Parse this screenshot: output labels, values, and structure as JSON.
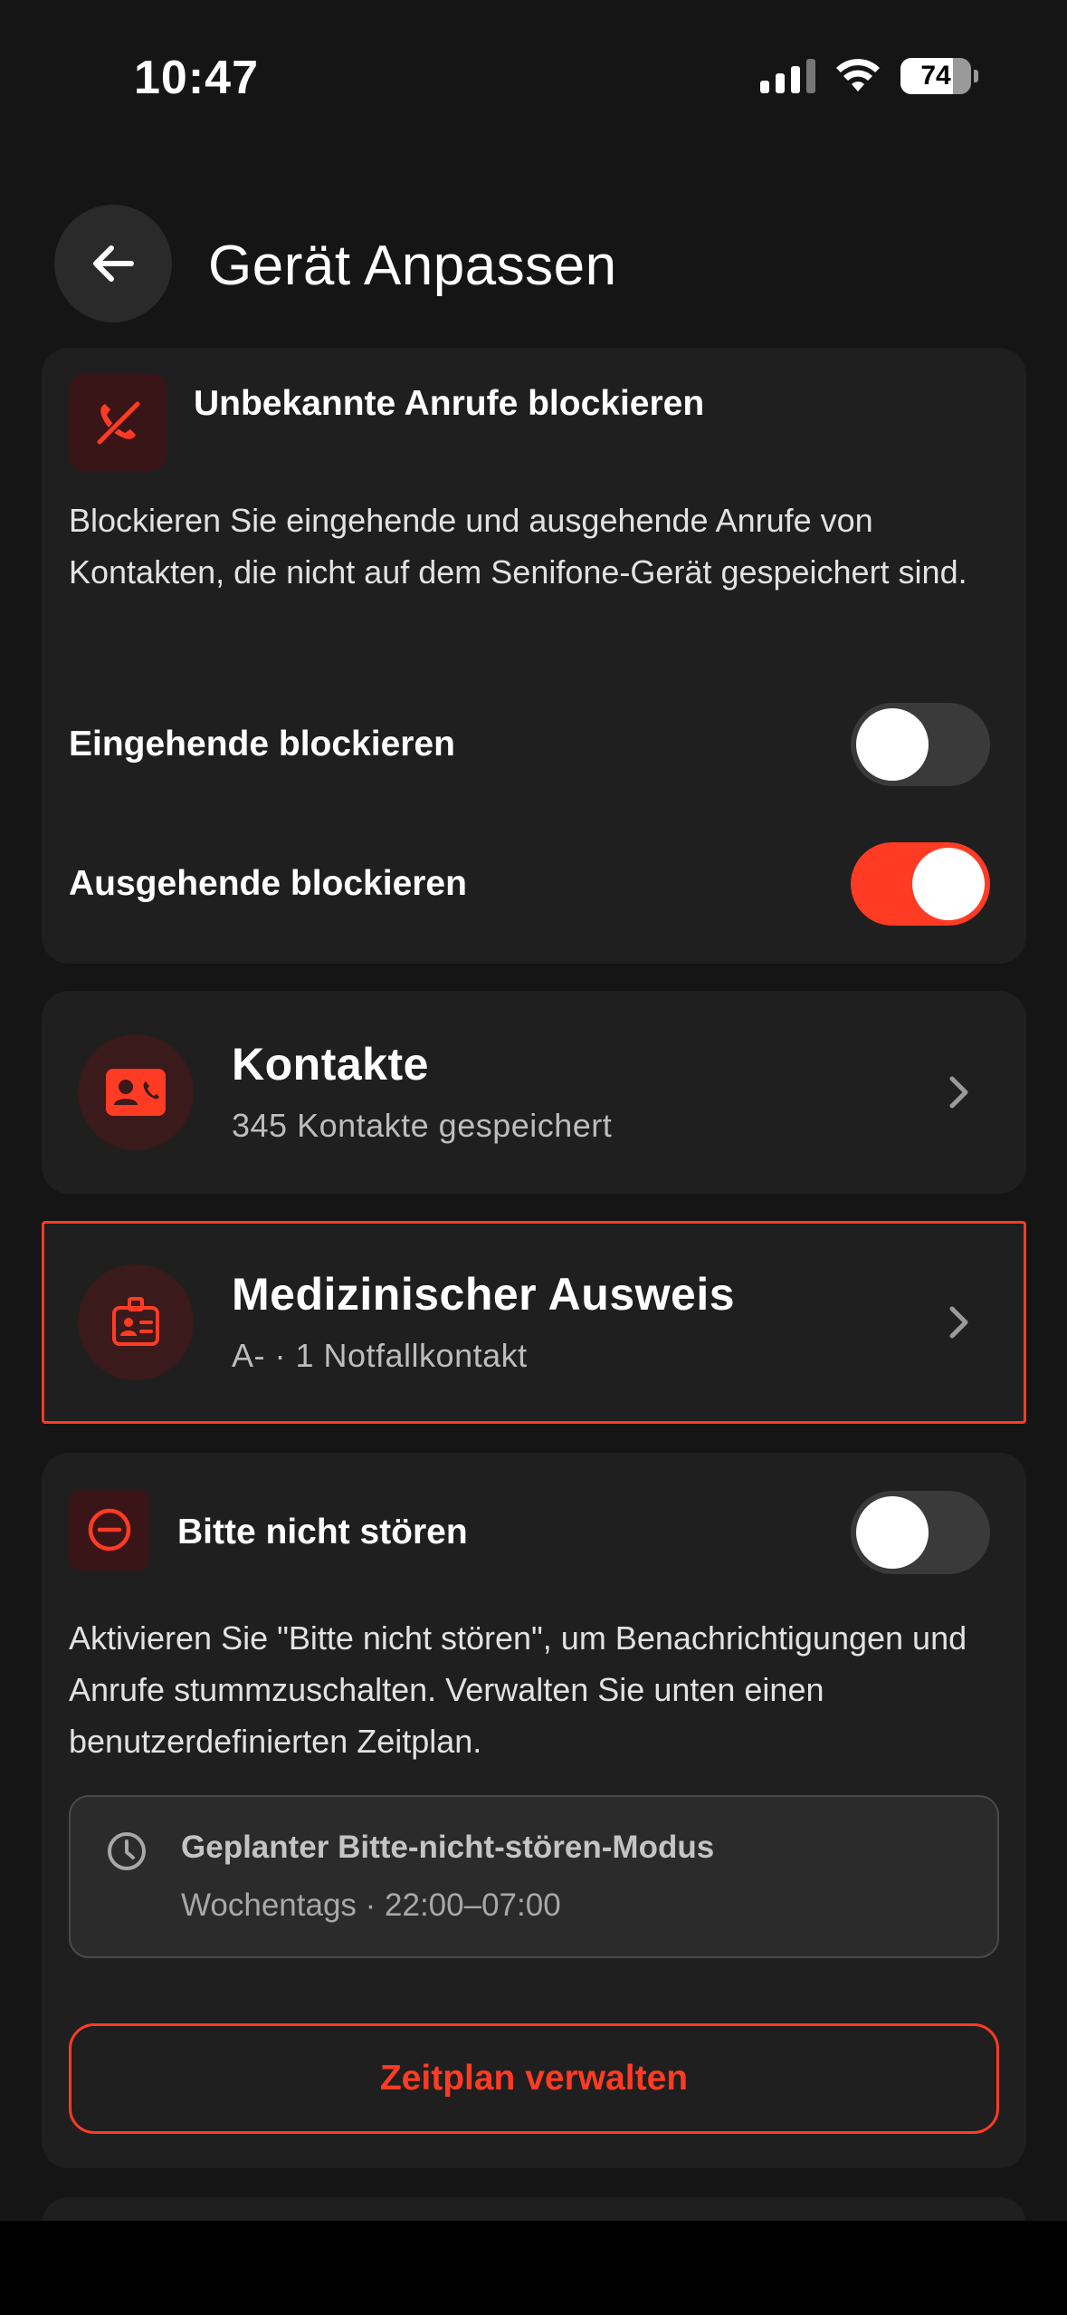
{
  "status_bar": {
    "time": "10:47",
    "battery": "74",
    "battery_level": 0.74
  },
  "header": {
    "title": "Gerät Anpassen"
  },
  "block_calls": {
    "title": "Unbekannte Anrufe blockieren",
    "description": "Blockieren Sie eingehende und ausgehende Anrufe von Kontakten, die nicht auf dem Senifone-Gerät gespeichert sind.",
    "incoming_label": "Eingehende blockieren",
    "incoming_enabled": false,
    "outgoing_label": "Ausgehende blockieren",
    "outgoing_enabled": true
  },
  "contacts": {
    "title": "Kontakte",
    "subtitle": "345 Kontakte gespeichert"
  },
  "medical_id": {
    "title": "Medizinischer Ausweis",
    "subtitle": "A- · 1 Notfallkontakt"
  },
  "dnd": {
    "title": "Bitte nicht stören",
    "enabled": false,
    "description": "Aktivieren Sie \"Bitte nicht stören\", um Benachrichtigungen und Anrufe stummzuschalten. Verwalten Sie unten einen benutzerdefinierten Zeitplan.",
    "schedule_title": "Geplanter Bitte-nicht-stören-Modus",
    "schedule_sub": "Wochentags · 22:00–07:00",
    "manage_button": "Zeitplan verwalten"
  },
  "colors": {
    "accent": "#ff3b24",
    "background": "#151515",
    "card": "#1f1f1f"
  },
  "icons": {
    "back": "arrow-left-icon",
    "block_calls": "phone-blocked-icon",
    "contacts": "contact-card-icon",
    "medical": "medical-id-icon",
    "dnd": "minus-circle-icon",
    "schedule": "clock-icon",
    "chevron": "chevron-right-icon"
  }
}
